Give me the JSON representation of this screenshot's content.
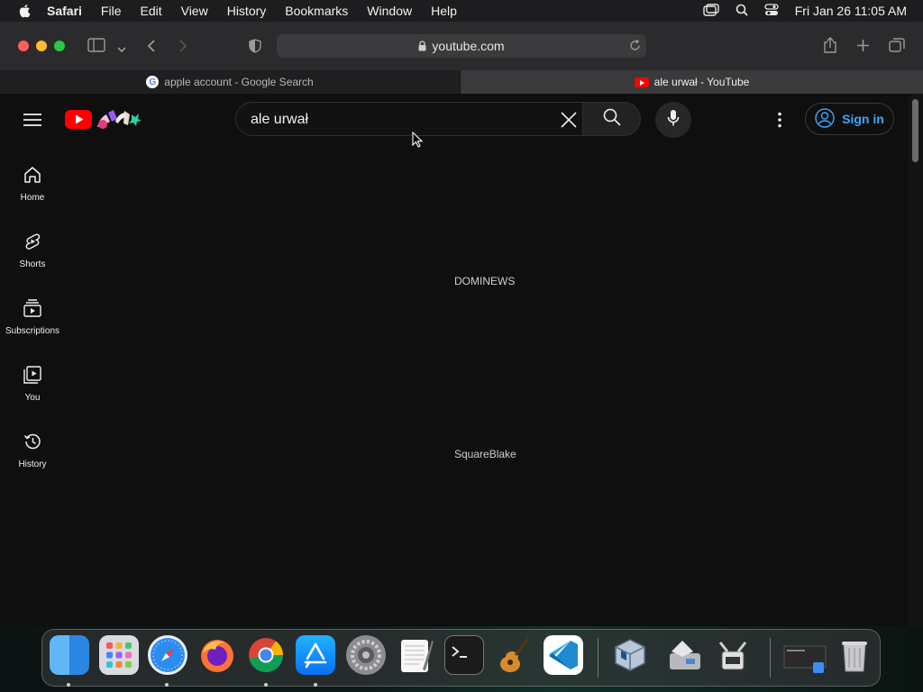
{
  "menubar": {
    "items": [
      "Safari",
      "File",
      "Edit",
      "View",
      "History",
      "Bookmarks",
      "Window",
      "Help"
    ],
    "clock": "Fri Jan 26  11:05 AM"
  },
  "browser": {
    "address": "youtube.com",
    "tabs": [
      {
        "label": "apple account - Google Search",
        "active": false
      },
      {
        "label": "ale urwał - YouTube",
        "active": true
      }
    ]
  },
  "youtube": {
    "search_value": "ale urwał",
    "sign_in_label": "Sign in",
    "sidebar": [
      {
        "label": "Home",
        "icon": "home-icon"
      },
      {
        "label": "Shorts",
        "icon": "shorts-icon"
      },
      {
        "label": "Subscriptions",
        "icon": "subscriptions-icon"
      },
      {
        "label": "You",
        "icon": "you-icon"
      },
      {
        "label": "History",
        "icon": "history-icon"
      }
    ],
    "results": [
      "DOMINEWS",
      "SquareBlake"
    ]
  },
  "colors": {
    "youtube_red": "#ff0000",
    "link_blue": "#3ea6ff",
    "page_bg": "#0f0f0f"
  }
}
